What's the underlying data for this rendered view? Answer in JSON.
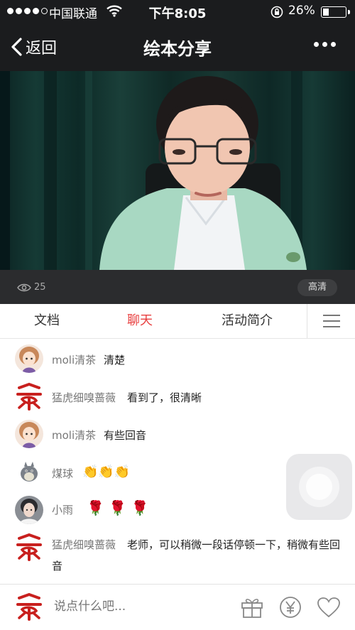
{
  "status_bar": {
    "carrier": "中国联通",
    "time": "下午8:05",
    "battery": "26%",
    "battery_level": 0.26
  },
  "nav": {
    "back_label": "返回",
    "title": "绘本分享"
  },
  "video": {
    "views": "25",
    "quality": "高清"
  },
  "tabs": [
    {
      "label": "文档"
    },
    {
      "label": "聊天"
    },
    {
      "label": "活动简介"
    }
  ],
  "active_tab": "聊天",
  "messages": [
    {
      "user": "moli清茶",
      "text": "清楚"
    },
    {
      "user": "猛虎细嗅蔷薇",
      "text": "看到了，很清晰"
    },
    {
      "user": "moli清茶",
      "text": "有些回音"
    },
    {
      "user": "煤球",
      "text": "👏👏👏"
    },
    {
      "user": "小雨",
      "text": "🌹 🌹 🌹"
    },
    {
      "user": "猛虎细嗅蔷薇",
      "text": "老师，可以稍微一段话停顿一下，稍微有些回音"
    }
  ],
  "composer": {
    "placeholder": "说点什么吧..."
  },
  "colors": {
    "accent": "#e83e3e",
    "topbar": "#1b1c1e",
    "video_info": "#2b2c2e"
  }
}
